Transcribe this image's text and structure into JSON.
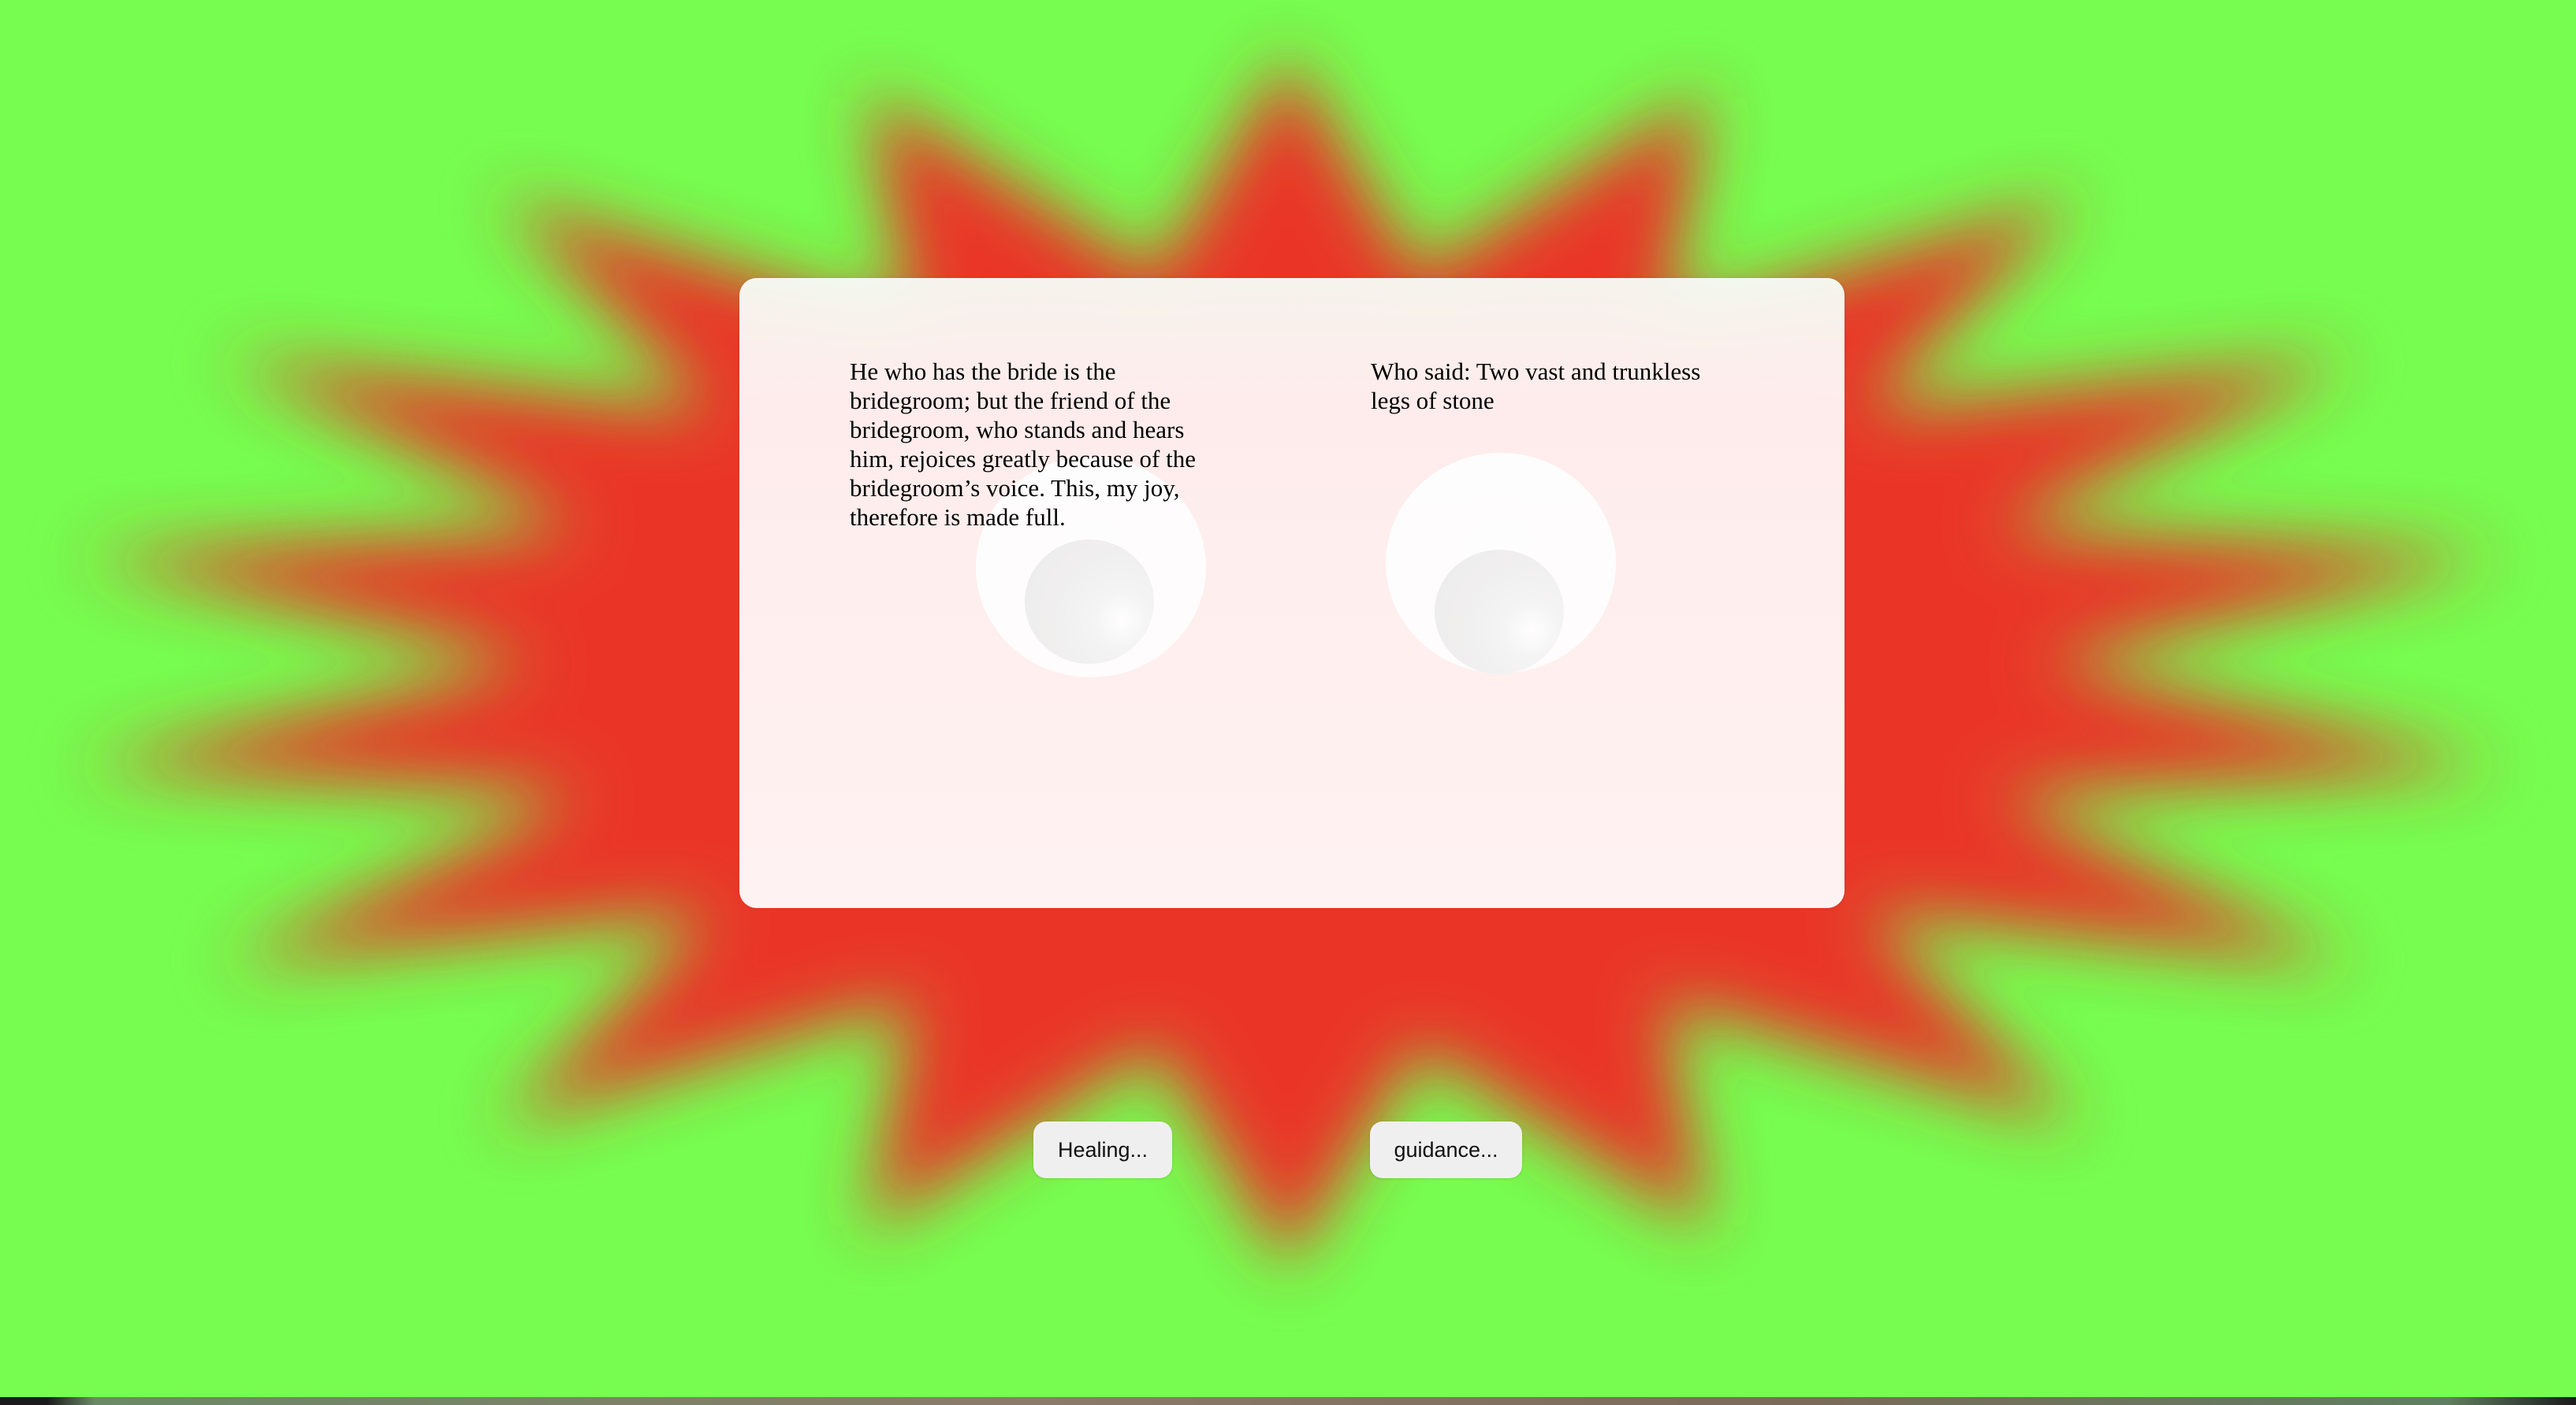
{
  "colors": {
    "background": "#76fd50",
    "burst": "#ea3427",
    "card": "#fff2f2",
    "button": "#f0eff0"
  },
  "quotes": {
    "left": "He who has the bride is the bridegroom; but the friend of the bridegroom, who stands and hears him, rejoices greatly because of the bridegroom’s voice. This, my joy, therefore is made full.",
    "right": "Who said: Two vast and trunkless legs of stone"
  },
  "buttons": {
    "healing_label": "Healing...",
    "guidance_label": "guidance..."
  }
}
